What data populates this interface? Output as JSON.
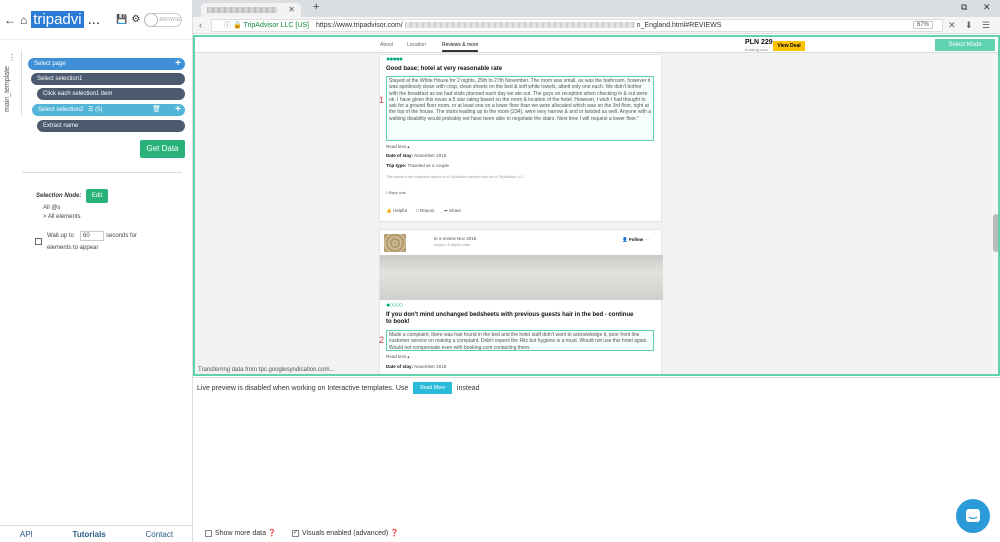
{
  "left": {
    "project_title": "tripadvi",
    "ellipsis": "...",
    "browse_label": "BROWSE",
    "vertical_tab": "main_template",
    "nodes": [
      {
        "label": "Select page"
      },
      {
        "label": "Select selection1"
      },
      {
        "label": "Click each selection1 item"
      },
      {
        "label": "Select selection2",
        "count": "(5)"
      },
      {
        "label": "Extract name"
      }
    ],
    "get_data": "Get Data",
    "selection_node": {
      "label": "Selection Node:",
      "edit": "Edit",
      "all_es": "All @s",
      "all_elements": "> All elements"
    },
    "wait": {
      "prefix": "Wait up to",
      "value": "60",
      "suffix": "seconds for",
      "line2": "elements to appear"
    },
    "footer": {
      "api": "API",
      "tutorials": "Tutorials",
      "contact": "Contact"
    }
  },
  "browser": {
    "security": "TripAdvisor LLC [US]",
    "url_start": "https://www.tripadvisor.com/",
    "url_end": "n_England.html#REVIEWS",
    "zoom": "67%",
    "page_nav": [
      "About",
      "Location",
      "Reviews & more"
    ],
    "price": "PLN 229",
    "price_src": "booking.com",
    "view_deal": "View Deal",
    "select_mode": "Select Mode",
    "review1": {
      "number": "1",
      "title": "Good base; hotel at very reasonable rate",
      "body": "Stayed at the White House for 2 nights, 25th to 27th November. The room was small, as was the bathroom, however it was spotlessly clean with crisp, clean sheets on the bed & soft white towels, albeit only one each. We didn't bother with the breakfast as we had visits planned each day we ate out. The guys on reception when checking in & out were ok. I have given this revue a 5 star rating based on the room & location of the hotel. However, I wish I had thought to ask for a ground floor room, or at least one on a lower floor than we were allocated which was on the 3rd floor, right at the top of the house. The stairs leading up to the room (234), were very narrow & and or twisted as well. Anyone with a walking disability would probably not have been able to negotiate the stairs. Next time I will request a lower floor.\"",
      "read_less": "Read less ▴",
      "date_label": "Date of stay:",
      "date_value": "November 2018",
      "trip_label": "Trip type:",
      "trip_value": "Traveled as a couple",
      "disclaimer": "This review is the subjective opinion of a TripAdvisor member and not of TripAdvisor LLC.",
      "reply": "1 Reply note",
      "helpful": "Helpful",
      "repost": "Repost",
      "share": "Share"
    },
    "review2": {
      "number": "2",
      "wrote": "te a review Nov 2018",
      "meta": "london • 8 helpful votes",
      "follow": "Follow",
      "title": "If you don't mind unchanged bedsheets with previous guests hair in the bed - continue to book!",
      "body": "Made a complaint, there was hair found in the bed and the hotel staff didn't want to acknowledge it, poor front line customer service on making a complaint. Didn't expect the Ritz but hygiene is a must. Would not use this hotel again. Would not compensate even with booking.com contacting them.",
      "read_less": "Read less ▴",
      "date_label": "Date of stay:",
      "date_value": "November 2018"
    },
    "loader": "Transferring data from tpc.googlesyndication.com..."
  },
  "preview": {
    "message_start": "Live preview is disabled when working on Interactive templates. Use",
    "read_more": "Read More",
    "message_end": "instead"
  },
  "bottom": {
    "show_more": "Show more data ❓",
    "visuals": "Visuals enabled (advanced) ❓"
  }
}
